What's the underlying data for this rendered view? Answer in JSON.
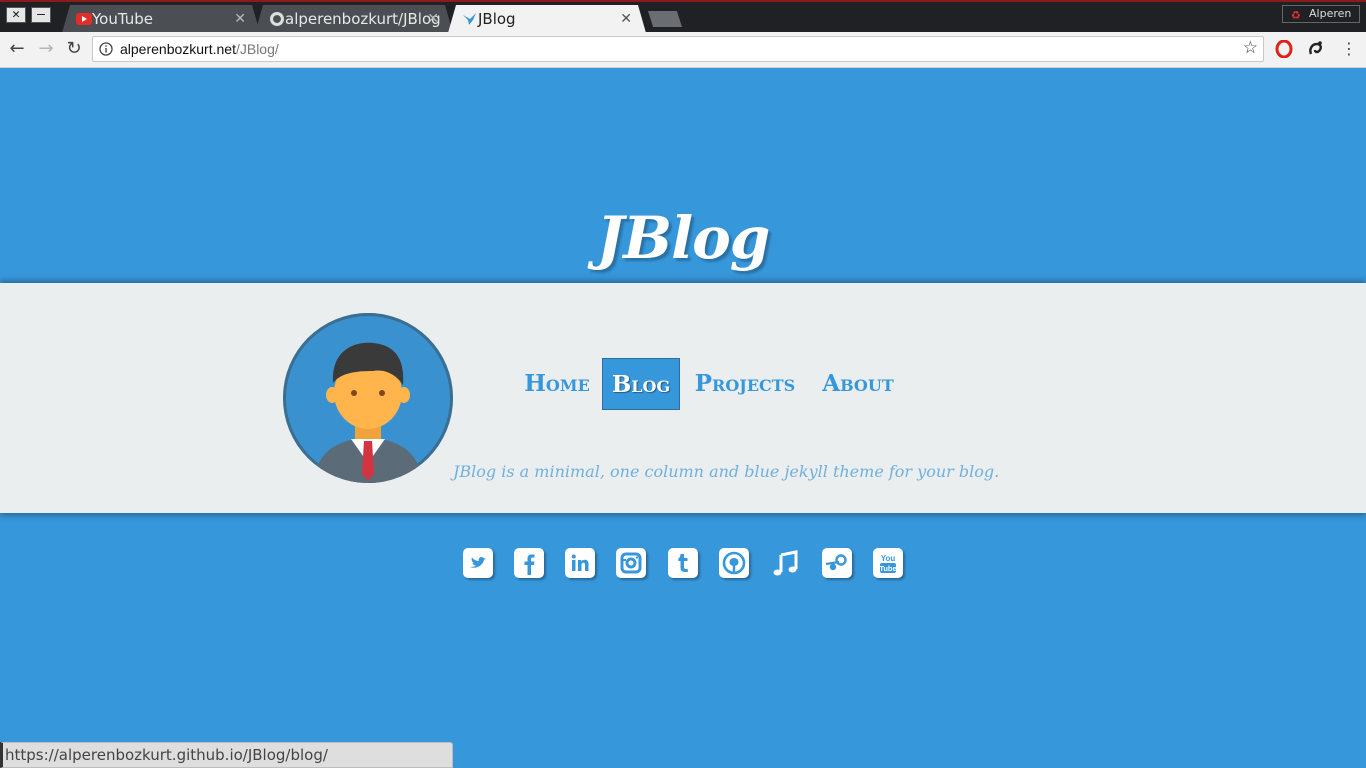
{
  "browser": {
    "tabs": [
      {
        "title": "YouTube",
        "icon": "youtube-icon"
      },
      {
        "title": "alperenbozkurt/JBlog",
        "icon": "github-icon"
      },
      {
        "title": "JBlog",
        "icon": "bird-icon"
      }
    ],
    "profile_name": "Alperen",
    "url_host": "alperenbozkurt.net",
    "url_path": "/JBlog/",
    "status_url": "https://alperenbozkurt.github.io/JBlog/blog/"
  },
  "site": {
    "title": "JBlog",
    "tagline": "JBlog is a minimal, one column and blue jekyll theme for your blog.",
    "nav": [
      {
        "label": "Home",
        "active": false
      },
      {
        "label": "Blog",
        "active": true
      },
      {
        "label": "Projects",
        "active": false
      },
      {
        "label": "About",
        "active": false
      }
    ],
    "social": [
      "twitter-icon",
      "facebook-icon",
      "linkedin-icon",
      "instagram-icon",
      "tumblr-icon",
      "github-icon",
      "music-icon",
      "steam-icon",
      "youtube-icon"
    ]
  },
  "colors": {
    "accent": "#3797db",
    "band": "#ebeeef",
    "tagline": "#6fb0df"
  }
}
